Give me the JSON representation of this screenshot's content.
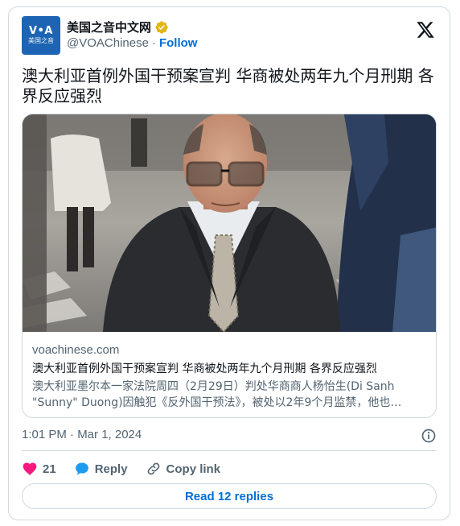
{
  "account": {
    "avatar_line1": "V•A",
    "avatar_line2": "美国之音",
    "display_name": "美国之音中文网",
    "handle": "@VOAChinese",
    "separator": "·",
    "follow_label": "Follow"
  },
  "tweet": {
    "text": "澳大利亚首例外国干预案宣判 华商被处两年九个月刑期 各界反应强烈"
  },
  "link_card": {
    "domain": "voachinese.com",
    "title": "澳大利亚首例外国干预案宣判 华商被处两年九个月刑期 各界反应强烈",
    "description": "澳大利亚墨尔本一家法院周四（2月29日）判处华商商人杨怡生(Di Sanh \"Sunny\" Duong)因触犯《反外国干预法》，被处以2年9个月监禁，他也…"
  },
  "meta": {
    "timestamp": "1:01 PM · Mar 1, 2024"
  },
  "actions": {
    "like_count": "21",
    "reply_label": "Reply",
    "copy_link_label": "Copy link"
  },
  "read_replies_label": "Read 12 replies",
  "colors": {
    "accent": "#006fd6",
    "like": "#f91880",
    "reply": "#1d9bf0",
    "muted": "#536471",
    "verified_gold": "#e2b719"
  }
}
